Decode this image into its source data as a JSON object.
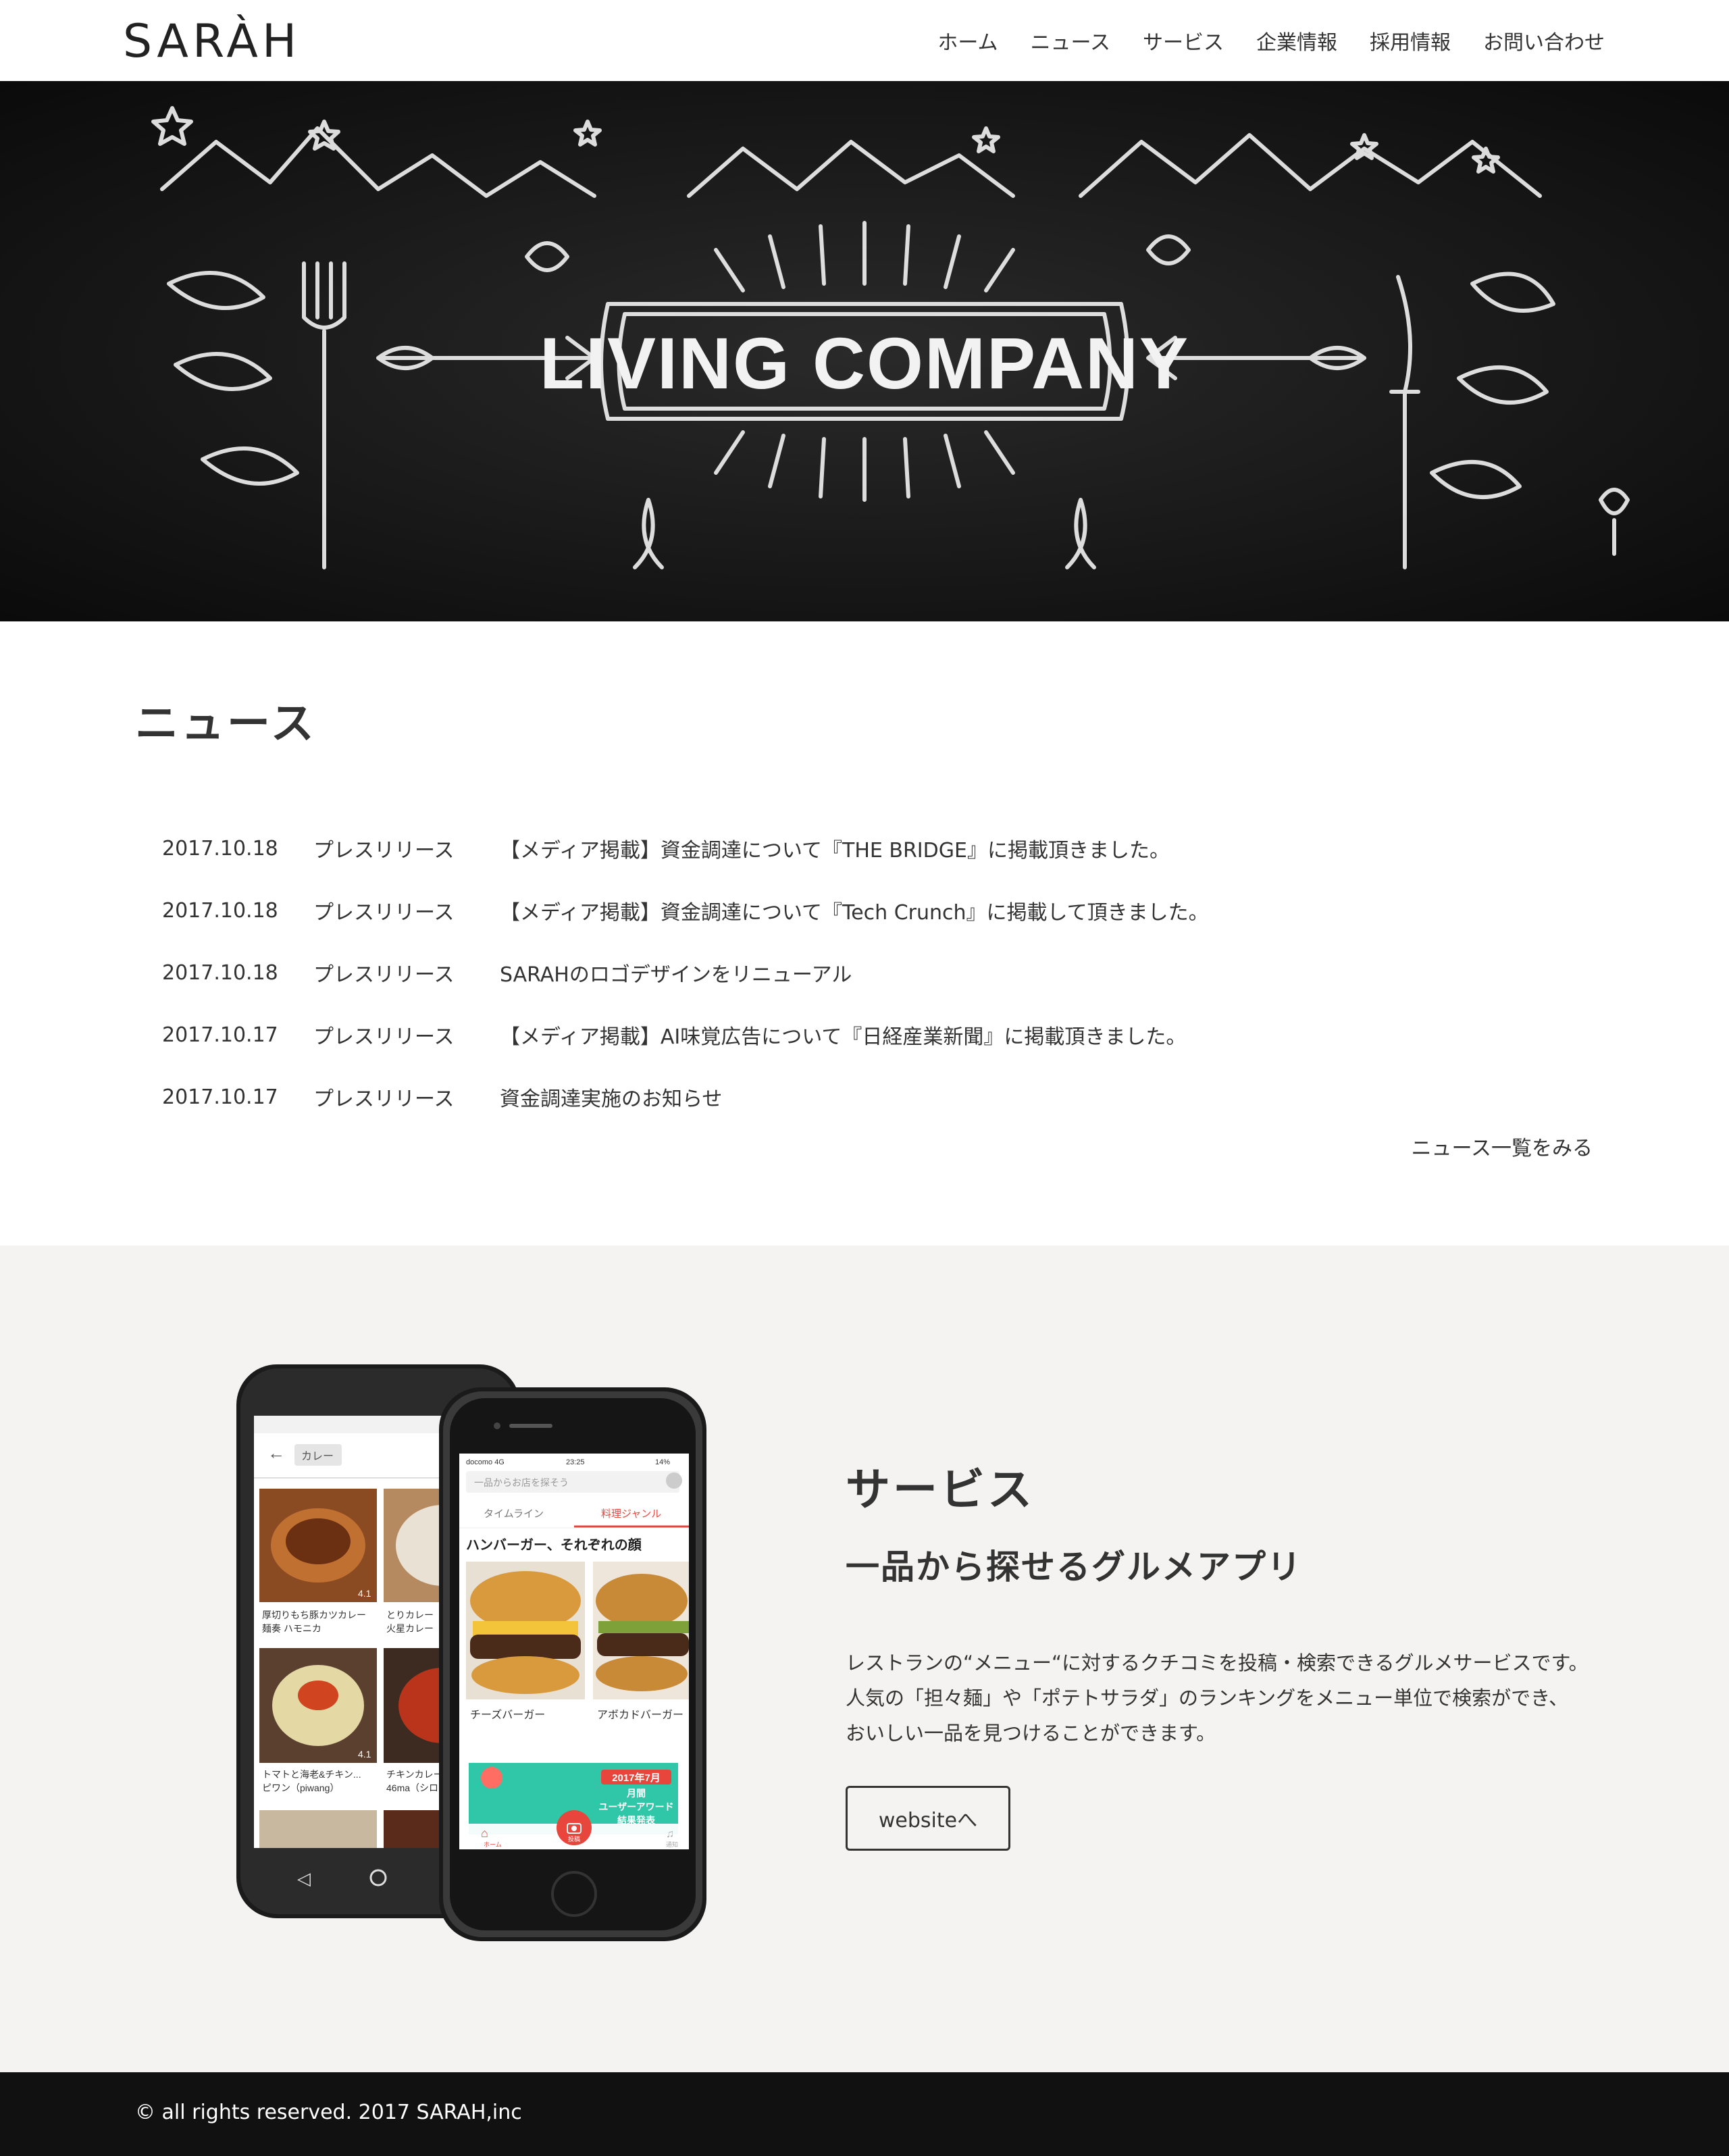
{
  "header": {
    "logo": "SARÀH",
    "nav": [
      "ホーム",
      "ニュース",
      "サービス",
      "企業情報",
      "採用情報",
      "お問い合わせ"
    ]
  },
  "hero": {
    "banner_text": "LIVING COMPANY"
  },
  "news": {
    "title": "ニュース",
    "items": [
      {
        "date": "2017.10.18",
        "category": "プレスリリース",
        "text": "【メディア掲載】資金調達について『THE BRIDGE』に掲載頂きました。"
      },
      {
        "date": "2017.10.18",
        "category": "プレスリリース",
        "text": "【メディア掲載】資金調達について『Tech Crunch』に掲載して頂きました。"
      },
      {
        "date": "2017.10.18",
        "category": "プレスリリース",
        "text": "SARAHのロゴデザインをリニューアル"
      },
      {
        "date": "2017.10.17",
        "category": "プレスリリース",
        "text": "【メディア掲載】AI味覚広告について『日経産業新聞』に掲載頂きました。"
      },
      {
        "date": "2017.10.17",
        "category": "プレスリリース",
        "text": "資金調達実施のお知らせ"
      }
    ],
    "more_link": "ニュース一覧をみる"
  },
  "service": {
    "title": "サービス",
    "subtitle": "一品から探せるグルメアプリ",
    "description": [
      "レストランの“メニュー“に対するクチコミを投稿・検索できるグルメサービスです。",
      "人気の「担々麺」や「ポテトサラダ」のランキングをメニュー単位で検索ができ、",
      "おいしい一品を見つけることができます。"
    ],
    "button": "websiteへ",
    "android_screen": {
      "search_chip": "カレー",
      "cards": [
        {
          "name1": "厚切りもち豚カツカレー",
          "name2": "麺奏 ハモニカ",
          "rating": "4.1"
        },
        {
          "name1": "とりカレー",
          "name2": "火星カレー",
          "rating": ""
        },
        {
          "name1": "トマトと海老&チキン...",
          "name2": "ピワン（piwang）",
          "rating": "4.1"
        },
        {
          "name1": "チキンカレー",
          "name2": "46ma（シロ",
          "rating": ""
        }
      ]
    },
    "iphone_screen": {
      "status_carrier": "docomo 4G",
      "status_time": "23:25",
      "status_battery": "14%",
      "search_placeholder": "一品からお店を探そう",
      "tab_timeline": "タイムライン",
      "tab_genre": "料理ジャンル",
      "section_title": "ハンバーガー、それぞれの顔",
      "item1": "チーズバーガー",
      "item2": "アボカドバーガー",
      "banner_line1": "2017年7月",
      "banner_line2": "月間",
      "banner_line3": "ユーザーアワード",
      "banner_line4": "結果発表",
      "nav_home": "ホーム",
      "nav_post": "投稿",
      "nav_notice": "通知"
    }
  },
  "footer": {
    "copyright": "© all rights reserved. 2017 SARAH,inc"
  }
}
